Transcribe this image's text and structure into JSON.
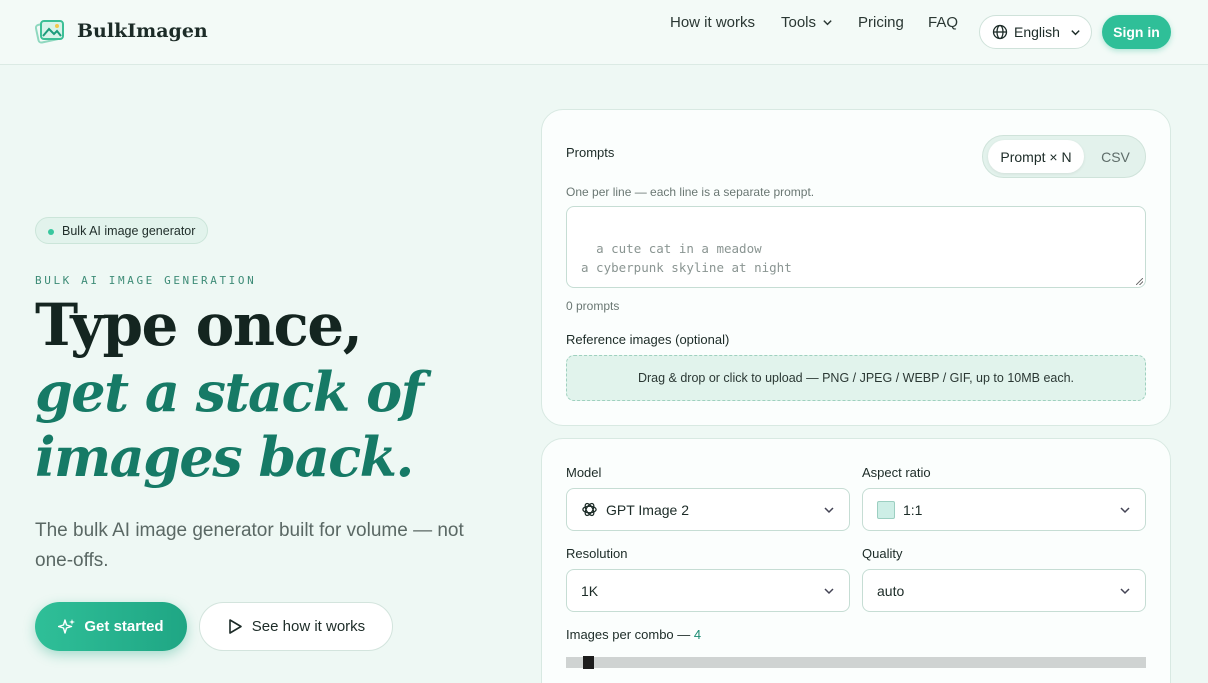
{
  "brand": {
    "name": "BulkImagen",
    "accent": "#2fbf98",
    "dark_accent": "#167a66"
  },
  "nav": {
    "how_it_works": "How it works",
    "tools": "Tools",
    "pricing": "Pricing",
    "faq": "FAQ",
    "language": "English",
    "sign_in": "Sign in"
  },
  "hero": {
    "badge": "Bulk AI image generator",
    "eyebrow": "BULK AI IMAGE GENERATION",
    "headline_1": "Type once,",
    "headline_2": "get a stack of",
    "headline_3": "images back.",
    "subtitle": "The bulk AI image generator built for volume — not one-offs.",
    "cta_primary": "Get started",
    "cta_secondary": "See how it works"
  },
  "prompts_card": {
    "label": "Prompts",
    "mode_active": "Prompt × N",
    "mode_inactive": "CSV",
    "hint": "One per line — each line is a separate prompt.",
    "placeholder": "a cute cat in a meadow\na cyberpunk skyline at night",
    "count": "0 prompts",
    "ref_label": "Reference images (optional)",
    "dropzone": "Drag & drop or click to upload — PNG / JPEG / WEBP / GIF, up to 10MB each."
  },
  "settings_card": {
    "model_label": "Model",
    "model_value": "GPT Image 2",
    "aspect_label": "Aspect ratio",
    "aspect_value": "1:1",
    "resolution_label": "Resolution",
    "resolution_value": "1K",
    "quality_label": "Quality",
    "quality_value": "auto",
    "images_per_combo_label": "Images per combo —",
    "images_per_combo_value": "4"
  }
}
